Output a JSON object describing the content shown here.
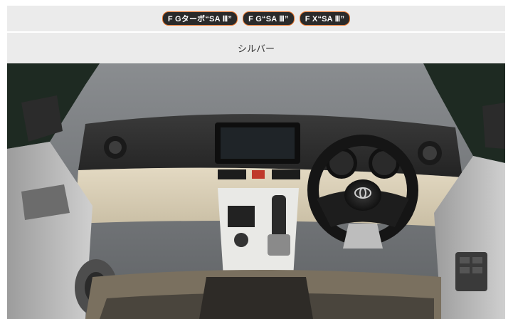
{
  "grade_tags": [
    {
      "label": "F Gターボ“SA Ⅲ”"
    },
    {
      "label": "F G“SA Ⅲ”"
    },
    {
      "label": "F X“SA Ⅲ”"
    }
  ],
  "color": {
    "name": "シルバー"
  },
  "photo": {
    "subject": "interior-dashboard-photo",
    "palette": {
      "backdrop": "#7a7d80",
      "dash_dark": "#2f2f2f",
      "dash_beige": "#d7ccb4",
      "door_trim": "#b8b8b8",
      "accent": "#c0392b"
    }
  }
}
